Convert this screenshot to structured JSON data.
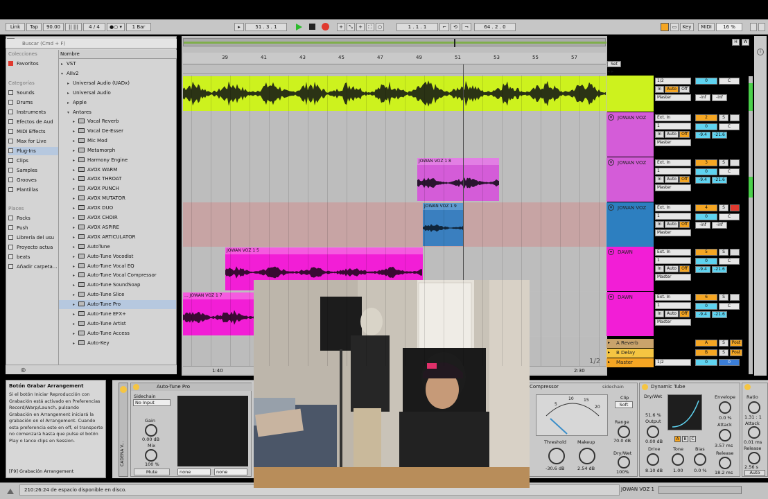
{
  "topbar": {
    "link": "Link",
    "tap": "Tap",
    "tempo": "90.00",
    "signature": "4 / 4",
    "quantize": "1 Bar",
    "position": "51 . 3 . 1",
    "punch_pos": "1 . 1 . 1",
    "loop_len": "64 . 2 . 0",
    "key": "Key",
    "midi": "MIDI",
    "cpu": "16 %"
  },
  "browser": {
    "search_placeholder": "Buscar (Cmd + F)",
    "header_colecciones": "Colecciones",
    "favoritos": "Favoritos",
    "header_categorias": "Categorías",
    "categories": [
      "Sounds",
      "Drums",
      "Instruments",
      "Efectos de Aud",
      "MIDI Effects",
      "Max for Live",
      "Plug-Ins",
      "Clips",
      "Samples",
      "Grooves",
      "Plantillas"
    ],
    "header_places": "Places",
    "places": [
      "Packs",
      "Push",
      "Librería del usu",
      "Proyecto actua",
      "beats",
      "Añadir carpeta..."
    ],
    "column_name": "Nombre",
    "tree": [
      "VST",
      "AIIv2",
      "Universal Audio (UADx)",
      "Universal Audio",
      "Apple",
      "Antares"
    ],
    "plugins": [
      "Vocal Reverb",
      "Vocal De-Esser",
      "Mic Mod",
      "Metamorph",
      "Harmony Engine",
      "AVOX WARM",
      "AVOX THROAT",
      "AVOX PUNCH",
      "AVOX MUTATOR",
      "AVOX DUO",
      "AVOX CHOIR",
      "AVOX ASPIRE",
      "AVOX ARTICULATOR",
      "AutoTune",
      "Auto-Tune Vocodist",
      "Auto-Tune Vocal EQ",
      "Auto-Tune Vocal Compressor",
      "Auto-Tune SoundSoap",
      "Auto-Tune Slice",
      "Auto-Tune Pro",
      "Auto-Tune EFX+",
      "Auto-Tune Artist",
      "Auto-Tune Access",
      "Auto-Key"
    ]
  },
  "ruler": {
    "bars": [
      "39",
      "41",
      "43",
      "45",
      "47",
      "49",
      "51",
      "53",
      "55",
      "57"
    ],
    "time_left": "1:40",
    "time_right": "2:30",
    "page": "1/2",
    "set": "Set"
  },
  "clips": {
    "c1": "JOWAN VOZ 1 8",
    "c2": "JOWAN VOZ 1 9",
    "c3": "JOWAN VOZ 1 5",
    "c4": "... JOWAN VOZ 1 7"
  },
  "tracks": [
    {
      "name": "",
      "input": "1/2",
      "chan": "",
      "num": "",
      "vol": "-inf",
      "pan": "-inf",
      "out": "Master",
      "color": "#cdf21e"
    },
    {
      "name": "JOWAN VOZ",
      "input": "Ext. In",
      "chan": "1",
      "num": "2",
      "vol": "-9.4",
      "pan": "-21.6",
      "out": "Master",
      "color": "#d45cd8"
    },
    {
      "name": "JOWAN VOZ",
      "input": "Ext. In",
      "chan": "1",
      "num": "3",
      "vol": "-9.4",
      "pan": "-21.6",
      "out": "Master",
      "color": "#d45cd8"
    },
    {
      "name": "JOWAN VOZ",
      "input": "Ext. In",
      "chan": "1",
      "num": "4",
      "vol": "-inf",
      "pan": "-inf",
      "out": "Master",
      "color": "#2d7fc0"
    },
    {
      "name": "DAWN",
      "input": "Ext. In",
      "chan": "1",
      "num": "5",
      "vol": "-9.4",
      "pan": "-21.6",
      "out": "Master",
      "color": "#f21ed6"
    },
    {
      "name": "DAWN",
      "input": "Ext. In",
      "chan": "1",
      "num": "6",
      "vol": "-9.4",
      "pan": "-21.6",
      "out": "Master",
      "color": "#f21ed6"
    }
  ],
  "mixer_common": {
    "in": "In",
    "auto": "Auto",
    "off": "Off",
    "zero": "0",
    "center": "C",
    "s": "S"
  },
  "returns": [
    {
      "name": "A Reverb",
      "letter": "A",
      "post": "Post"
    },
    {
      "name": "B Delay",
      "letter": "B",
      "post": "Post"
    },
    {
      "name": "Master",
      "letter": "",
      "post": "",
      "input": "1/2"
    }
  ],
  "info": {
    "title": "Botón Grabar Arrangement",
    "body": "Si el botón Iniciar Reproducción con Grabación está activado en Preferencias Record/Warp/Launch, pulsando Grabación en Arrangement iniciará la grabación en el Arrangement. Cuando esta preferencia este en off, el transporte no comenzará hasta que pulse el botón Play o lance clips en Session.",
    "shortcut": "[F9] Grabación Arrangement"
  },
  "devices": {
    "rack_label": "CADENA V...",
    "autotune_title": "Auto-Tune Pro",
    "sidechain": "Sidechain",
    "no_input": "No Input",
    "gain": "Gain",
    "gain_val": "0.00 dB",
    "mix": "Mix",
    "mix_val": "100 %",
    "mute": "Mute",
    "none1": "none",
    "none2": "none",
    "compressor_title": "Compressor",
    "sidechain_link": "sidechain",
    "comp_scale": [
      "5",
      "10",
      "15",
      "20"
    ],
    "clip": "Clip",
    "soft": "Soft",
    "threshold": "Threshold",
    "threshold_val": "-30.6 dB",
    "makeup": "Makeup",
    "makeup_val": "2.54 dB",
    "range": "Range",
    "range_val": "70.0 dB",
    "drywet": "Dry/Wet",
    "drywet_val": "100%",
    "tube_title": "Dynamic Tube",
    "tube_drywet": "Dry/Wet",
    "tube_drywet_val": "51.6 %",
    "tube_output": "Output",
    "tube_output_val": "0.00 dB",
    "tube_drive": "Drive",
    "tube_drive_val": "8.10 dB",
    "tube_tone": "Tone",
    "tube_tone_val": "1.00",
    "tube_bias": "Bias",
    "tube_bias_val": "0.0 %",
    "tube_abc": [
      "A",
      "B",
      "C"
    ],
    "envelope": "Envelope",
    "envelope_val": "0.0 %",
    "attack": "Attack",
    "attack_val": "3.57 ms",
    "release": "Release",
    "release_val": "18.2 ms",
    "ratio": "Ratio",
    "ratio_val": "1.31 : 1",
    "attack2": "Attack",
    "attack2_val": "0.01 ms",
    "release2": "Release",
    "release2_val": "2.56 s",
    "auto": "Auto"
  },
  "status": {
    "disk": "210:26:24 de espacio disponible en disco.",
    "track": "JOWAN VOZ 1"
  },
  "colors": {
    "lime": "#cdf21e",
    "magenta": "#f21ed6",
    "violet": "#d45cd8",
    "blue": "#2d7fc0",
    "orange": "#f5a623",
    "cyan": "#5fd3f0"
  }
}
